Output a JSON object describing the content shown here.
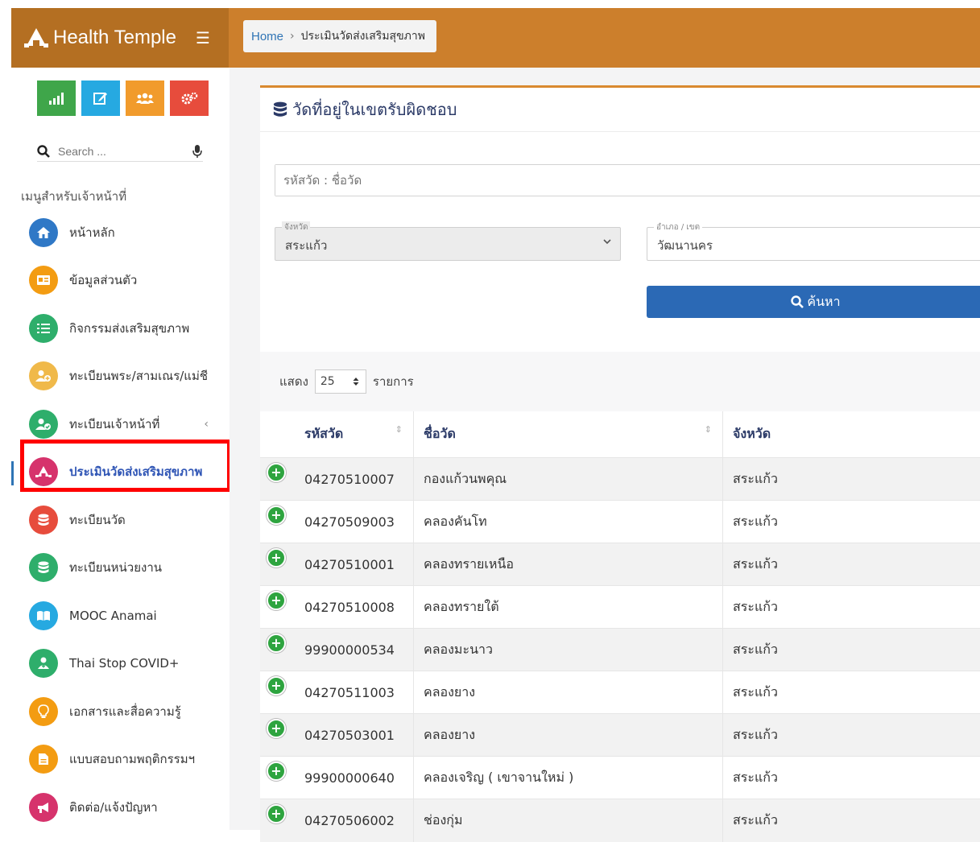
{
  "app": {
    "name": "Health Temple"
  },
  "breadcrumb": {
    "home": "Home",
    "separator": "›",
    "current": "ประเมินวัดส่งเสริมสุขภาพ"
  },
  "sidebar": {
    "quick_buttons": [
      {
        "icon": "bar-chart-icon",
        "color": "#3fa64a"
      },
      {
        "icon": "edit-icon",
        "color": "#26a9e1"
      },
      {
        "icon": "users-icon",
        "color": "#f19b2c"
      },
      {
        "icon": "cogs-icon",
        "color": "#e74c3c"
      }
    ],
    "search_placeholder": "Search ...",
    "menu_title": "เมนูสำหรับเจ้าหน้าที่",
    "items": [
      {
        "label": "หน้าหลัก",
        "icon": "home-icon",
        "color": "#2f78c6"
      },
      {
        "label": "ข้อมูลส่วนตัว",
        "icon": "id-card-icon",
        "color": "#f39c12"
      },
      {
        "label": "กิจกรรมส่งเสริมสุขภาพ",
        "icon": "list-icon",
        "color": "#2eae6b"
      },
      {
        "label": "ทะเบียนพระ/สามเณร/แม่ชี",
        "icon": "user-add-icon",
        "color": "#f0b94a"
      },
      {
        "label": "ทะเบียนเจ้าหน้าที่",
        "icon": "user-check-icon",
        "color": "#2eae6b",
        "chevron": "‹"
      },
      {
        "label": "ประเมินวัดส่งเสริมสุขภาพ",
        "icon": "temple-icon",
        "color": "#d6336c",
        "active": true
      },
      {
        "label": "ทะเบียนวัด",
        "icon": "database-icon",
        "color": "#e74c3c"
      },
      {
        "label": "ทะเบียนหน่วยงาน",
        "icon": "database-icon",
        "color": "#2eae6b"
      },
      {
        "label": "MOOC Anamai",
        "icon": "book-icon",
        "color": "#26a9e1"
      },
      {
        "label": "Thai Stop COVID+",
        "icon": "health-user-icon",
        "color": "#2eae6b"
      },
      {
        "label": "เอกสารและสื่อความรู้",
        "icon": "lightbulb-icon",
        "color": "#f39c12"
      },
      {
        "label": "แบบสอบถามพฤติกรรมฯ",
        "icon": "document-icon",
        "color": "#f39c12"
      },
      {
        "label": "ติดต่อ/แจ้งปัญหา",
        "icon": "megaphone-icon",
        "color": "#d6336c"
      }
    ]
  },
  "main": {
    "card_title": "วัดที่อยู่ในเขตรับผิดชอบ",
    "keyword_placeholder": "รหัสวัด : ชื่อวัด",
    "province": {
      "legend": "จังหวัด",
      "value": "สระแก้ว"
    },
    "district": {
      "legend": "อำเภอ / เขต",
      "value": "วัฒนานคร"
    },
    "search_button": "ค้นหา",
    "show_label": "แสดง",
    "page_length": "25",
    "records_label": "รายการ",
    "columns": [
      "รหัสวัด",
      "ชื่อวัด",
      "จังหวัด"
    ],
    "rows": [
      {
        "code": "04270510007",
        "name": "กองแก้วนพคุณ",
        "province": "สระแก้ว"
      },
      {
        "code": "04270509003",
        "name": "คลองคันโท",
        "province": "สระแก้ว"
      },
      {
        "code": "04270510001",
        "name": "คลองทรายเหนือ",
        "province": "สระแก้ว"
      },
      {
        "code": "04270510008",
        "name": "คลองทรายใต้",
        "province": "สระแก้ว"
      },
      {
        "code": "99900000534",
        "name": "คลองมะนาว",
        "province": "สระแก้ว"
      },
      {
        "code": "04270511003",
        "name": "คลองยาง",
        "province": "สระแก้ว"
      },
      {
        "code": "04270503001",
        "name": "คลองยาง",
        "province": "สระแก้ว"
      },
      {
        "code": "99900000640",
        "name": "คลองเจริญ ( เขาจานใหม่ )",
        "province": "สระแก้ว"
      },
      {
        "code": "04270506002",
        "name": "ช่องกุ่ม",
        "province": "สระแก้ว"
      }
    ]
  }
}
